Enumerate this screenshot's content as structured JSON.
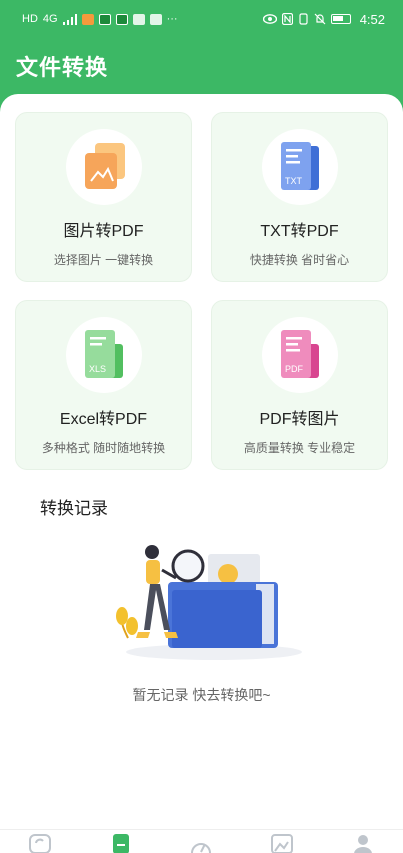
{
  "status_bar": {
    "left_text": "HD",
    "signal_text": "4G",
    "more": "···",
    "time": "4:52"
  },
  "header": {
    "title": "文件转换"
  },
  "cards": [
    {
      "title": "图片转PDF",
      "subtitle": "选择图片 一键转换",
      "icon": "image-file-icon",
      "badge": ""
    },
    {
      "title": "TXT转PDF",
      "subtitle": "快捷转换 省时省心",
      "icon": "txt-file-icon",
      "badge": "TXT"
    },
    {
      "title": "Excel转PDF",
      "subtitle": "多种格式 随时随地转换",
      "icon": "xls-file-icon",
      "badge": "XLS"
    },
    {
      "title": "PDF转图片",
      "subtitle": "高质量转换 专业稳定",
      "icon": "pdf-file-icon",
      "badge": "PDF"
    }
  ],
  "records": {
    "title": "转换记录",
    "empty_text": "暂无记录 快去转换吧~"
  },
  "tabbar": {
    "items": [
      {
        "icon": "convert-icon"
      },
      {
        "icon": "document-icon",
        "active": true
      },
      {
        "icon": "gauge-icon"
      },
      {
        "icon": "image-icon"
      },
      {
        "icon": "user-icon"
      }
    ]
  },
  "colors": {
    "brand": "#3cb865",
    "card_bg": "#f1faf1",
    "image_icon": "#f6a55a",
    "txt_icon": "#4a7ce0",
    "xls_icon": "#5cc86a",
    "pdf_icon": "#e0559b"
  }
}
